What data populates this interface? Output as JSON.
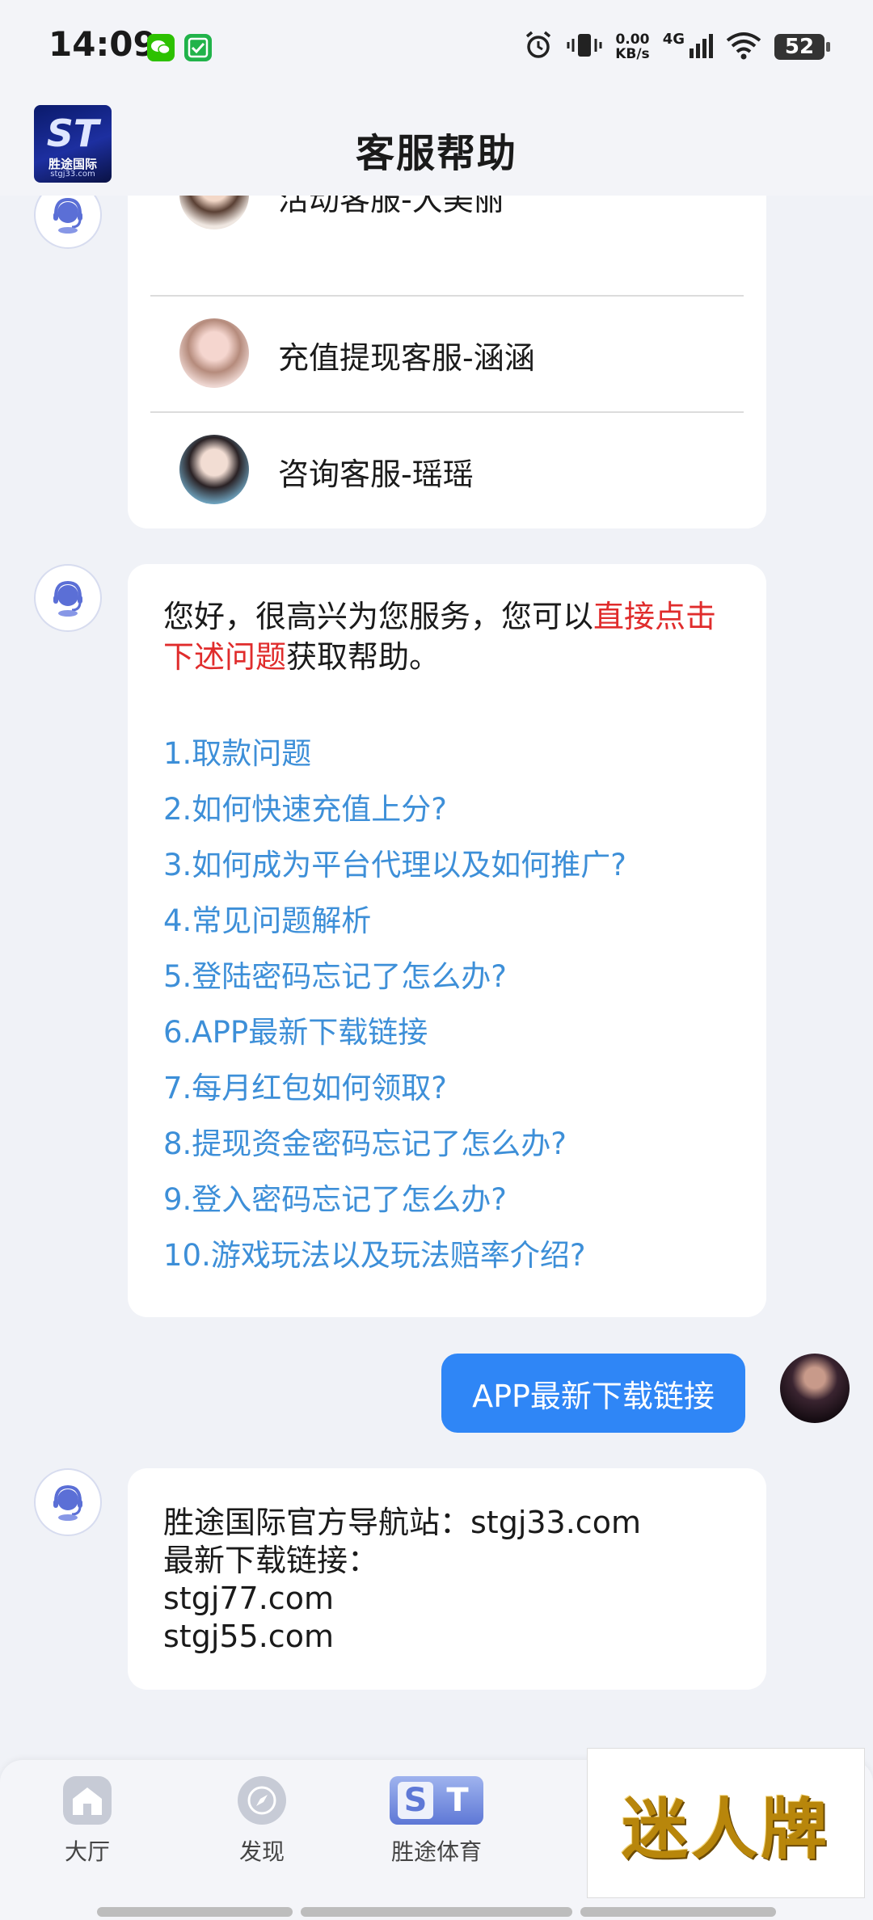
{
  "status_bar": {
    "time": "14:09",
    "speed_value": "0.00",
    "speed_unit": "KB/s",
    "network": "4G",
    "battery": "52"
  },
  "header": {
    "title": "客服帮助",
    "logo_mark": "ST",
    "logo_name": "胜途国际",
    "logo_url": "stgj33.com"
  },
  "service_list": [
    {
      "name": "活动客服-大美丽"
    },
    {
      "name": "充值提现客服-涵涵"
    },
    {
      "name": "咨询客服-瑶瑶"
    }
  ],
  "greeting": {
    "part1": "您好，很高兴为您服务，您可以",
    "highlight": "直接点击下述问题",
    "part2": "获取帮助。"
  },
  "questions": [
    "1.取款问题",
    "2.如何快速充值上分?",
    "3.如何成为平台代理以及如何推广?",
    "4.常见问题解析",
    "5.登陆密码忘记了怎么办?",
    "6.APP最新下载链接",
    "7.每月红包如何领取?",
    "8.提现资金密码忘记了怎么办?",
    "9.登入密码忘记了怎么办?",
    "10.游戏玩法以及玩法赔率介绍?"
  ],
  "user_message": "APP最新下载链接",
  "answer_lines": [
    "胜途国际官方导航站：stgj33.com",
    "最新下载链接：",
    "stgj77.com",
    "stgj55.com"
  ],
  "bottom_nav": {
    "items": [
      {
        "label": "大厅",
        "icon": "home-icon"
      },
      {
        "label": "发现",
        "icon": "compass-icon"
      },
      {
        "label": "胜途体育",
        "icon": "st-sports-icon",
        "mark_s": "S",
        "mark_t": "T"
      }
    ],
    "banner_text": "迷人牌"
  },
  "colors": {
    "accent_blue": "#2f86f6",
    "link_blue": "#3d8fd8",
    "highlight_red": "#e02c2c"
  }
}
